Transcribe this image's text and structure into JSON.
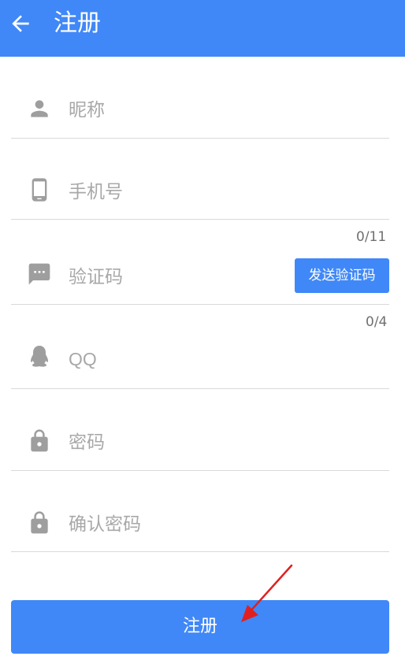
{
  "header": {
    "title": "注册",
    "back_icon": "arrow-left-icon"
  },
  "form": {
    "nickname": {
      "placeholder": "昵称",
      "icon": "person-icon"
    },
    "phone": {
      "placeholder": "手机号",
      "icon": "smartphone-icon",
      "counter": "0/11"
    },
    "code": {
      "placeholder": "验证码",
      "icon": "message-icon",
      "counter": "0/4",
      "send_label": "发送验证码"
    },
    "qq": {
      "placeholder": "QQ",
      "icon": "penguin-icon"
    },
    "password": {
      "placeholder": "密码",
      "icon": "lock-icon"
    },
    "confirm_password": {
      "placeholder": "确认密码",
      "icon": "lock-icon"
    }
  },
  "submit": {
    "label": "注册"
  },
  "colors": {
    "primary": "#4088f7",
    "icon_gray": "#9e9e9e",
    "placeholder_gray": "#a8a8a8",
    "annotation_red": "#e02020"
  }
}
